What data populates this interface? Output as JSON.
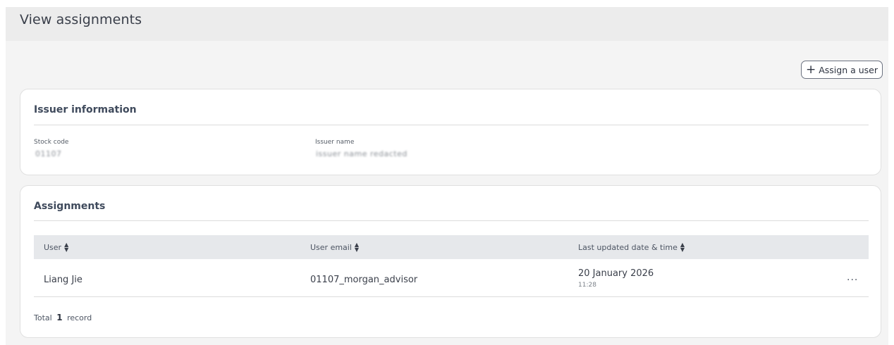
{
  "page": {
    "title": "View assignments"
  },
  "toolbar": {
    "assign_label": "Assign a user",
    "assign_icon": "plus-icon"
  },
  "issuer": {
    "title": "Issuer information",
    "stock_code_label": "Stock code",
    "stock_code_value": "01107",
    "issuer_name_label": "Issuer name",
    "issuer_name_value": "issuer name redacted"
  },
  "assignments": {
    "title": "Assignments",
    "columns": {
      "user": "User",
      "email": "User email",
      "updated": "Last updated date & time"
    },
    "rows": [
      {
        "user": "Liang Jie",
        "email": "01107_morgan_advisor",
        "date": "20 January 2026",
        "time": "11:28",
        "actions": "···"
      }
    ],
    "total_prefix": "Total",
    "total_count": "1",
    "total_suffix": "record"
  },
  "colors": {
    "background": "#f4f4f4",
    "topbar": "#ececec",
    "table_header": "#e6e8eb",
    "card": "#ffffff"
  }
}
